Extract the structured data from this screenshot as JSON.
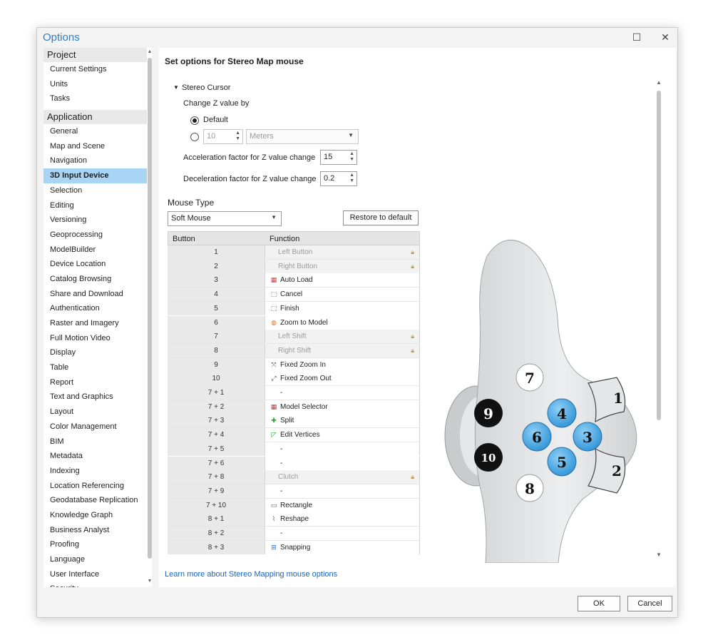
{
  "window": {
    "title": "Options",
    "maximize_glyph": "☐",
    "close_glyph": "✕"
  },
  "sidebar": {
    "groups": [
      {
        "label": "Project",
        "items": [
          "Current Settings",
          "Units",
          "Tasks"
        ]
      },
      {
        "label": "Application",
        "items": [
          "General",
          "Map and Scene",
          "Navigation",
          "3D Input Device",
          "Selection",
          "Editing",
          "Versioning",
          "Geoprocessing",
          "ModelBuilder",
          "Device Location",
          "Catalog Browsing",
          "Share and Download",
          "Authentication",
          "Raster and Imagery",
          "Full Motion Video",
          "Display",
          "Table",
          "Report",
          "Text and Graphics",
          "Layout",
          "Color Management",
          "BIM",
          "Metadata",
          "Indexing",
          "Location Referencing",
          "Geodatabase Replication",
          "Knowledge Graph",
          "Business Analyst",
          "Proofing",
          "Language",
          "User Interface",
          "Security"
        ]
      }
    ],
    "selected": "3D Input Device"
  },
  "main": {
    "heading": "Set options for Stereo Map mouse",
    "stereo_cursor": {
      "label": "Stereo Cursor",
      "change_z_label": "Change Z value by",
      "radio_default": "Default",
      "custom_value": "10",
      "custom_unit": "Meters",
      "accel_label": "Acceleration factor for Z value change",
      "accel_value": "15",
      "decel_label": "Deceleration factor for Z value change",
      "decel_value": "0.2"
    },
    "mouse_type": {
      "label": "Mouse Type",
      "selected": "Soft Mouse",
      "restore_label": "Restore to default"
    },
    "grid": {
      "col_button": "Button",
      "col_function": "Function",
      "rows": [
        {
          "button": "1",
          "function": "Left Button",
          "locked": true,
          "icon": ""
        },
        {
          "button": "2",
          "function": "Right Button",
          "locked": true,
          "icon": ""
        },
        {
          "button": "3",
          "function": "Auto Load",
          "locked": false,
          "icon": "auto-load-icon"
        },
        {
          "button": "4",
          "function": "Cancel",
          "locked": false,
          "icon": "cancel-icon"
        },
        {
          "button": "5",
          "function": "Finish",
          "locked": false,
          "icon": "finish-icon"
        },
        {
          "button": "6",
          "function": "Zoom to Model",
          "locked": false,
          "icon": "zoom-to-model-icon"
        },
        {
          "button": "7",
          "function": "Left Shift",
          "locked": true,
          "icon": ""
        },
        {
          "button": "8",
          "function": "Right Shift",
          "locked": true,
          "icon": ""
        },
        {
          "button": "9",
          "function": "Fixed Zoom In",
          "locked": false,
          "icon": "fixed-zoom-in-icon"
        },
        {
          "button": "10",
          "function": "Fixed Zoom Out",
          "locked": false,
          "icon": "fixed-zoom-out-icon"
        },
        {
          "button": "7 + 1",
          "function": "-",
          "locked": false,
          "icon": ""
        },
        {
          "button": "7 + 2",
          "function": "Model Selector",
          "locked": false,
          "icon": "model-selector-icon"
        },
        {
          "button": "7 + 3",
          "function": "Split",
          "locked": false,
          "icon": "split-icon"
        },
        {
          "button": "7 + 4",
          "function": "Edit Vertices",
          "locked": false,
          "icon": "edit-vertices-icon"
        },
        {
          "button": "7 + 5",
          "function": "-",
          "locked": false,
          "icon": ""
        },
        {
          "button": "7 + 6",
          "function": "-",
          "locked": false,
          "icon": ""
        },
        {
          "button": "7 + 8",
          "function": "Clutch",
          "locked": true,
          "icon": ""
        },
        {
          "button": "7 + 9",
          "function": "-",
          "locked": false,
          "icon": ""
        },
        {
          "button": "7 + 10",
          "function": "Rectangle",
          "locked": false,
          "icon": "rectangle-icon"
        },
        {
          "button": "8 + 1",
          "function": "Reshape",
          "locked": false,
          "icon": "reshape-icon"
        },
        {
          "button": "8 + 2",
          "function": "-",
          "locked": false,
          "icon": ""
        },
        {
          "button": "8 + 3",
          "function": "Snapping",
          "locked": false,
          "icon": "snapping-icon"
        }
      ]
    },
    "mouse_image": {
      "buttons": [
        "1",
        "2",
        "3",
        "4",
        "5",
        "6",
        "7",
        "8",
        "9",
        "10"
      ]
    },
    "learn_more": "Learn more about Stereo Mapping mouse options"
  },
  "footer": {
    "ok_label": "OK",
    "cancel_label": "Cancel"
  },
  "colors": {
    "title": "#2f7fc7",
    "selected_item": "#a8d4f5",
    "mouse_blue": "#4aaee8",
    "link": "#1a63b8"
  }
}
